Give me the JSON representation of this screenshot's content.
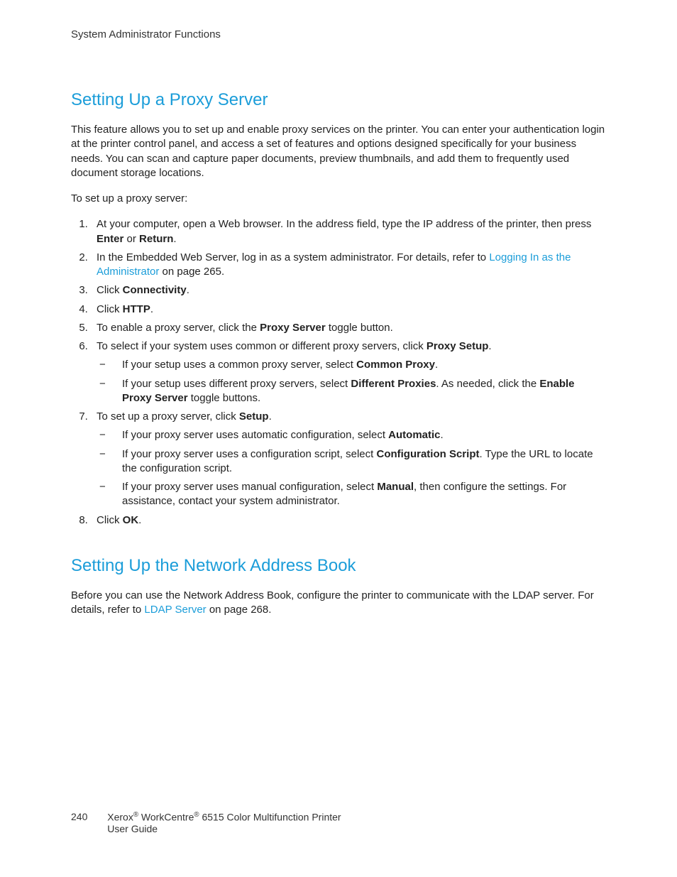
{
  "runningHead": "System Administrator Functions",
  "section1": {
    "title": "Setting Up a Proxy Server",
    "intro": "This feature allows you to set up and enable proxy services on the printer. You can enter your authentication login at the printer control panel, and access a set of features and options designed specifically for your business needs. You can scan and capture paper documents, preview thumbnails, and add them to frequently used document storage locations.",
    "lead": "To set up a proxy server:",
    "step1_a": "At your computer, open a Web browser. In the address field, type the IP address of the printer, then press ",
    "step1_b": "Enter",
    "step1_c": " or ",
    "step1_d": "Return",
    "step1_e": ".",
    "step2_a": "In the Embedded Web Server, log in as a system administrator. For details, refer to ",
    "step2_link": "Logging In as the Administrator",
    "step2_b": " on page 265.",
    "step3_a": "Click ",
    "step3_b": "Connectivity",
    "step3_c": ".",
    "step4_a": "Click ",
    "step4_b": "HTTP",
    "step4_c": ".",
    "step5_a": "To enable a proxy server, click the ",
    "step5_b": "Proxy Server",
    "step5_c": " toggle button.",
    "step6_a": "To select if your system uses common or different proxy servers, click ",
    "step6_b": "Proxy Setup",
    "step6_c": ".",
    "step6_s1_a": "If your setup uses a common proxy server, select ",
    "step6_s1_b": "Common Proxy",
    "step6_s1_c": ".",
    "step6_s2_a": "If your setup uses different proxy servers, select ",
    "step6_s2_b": "Different Proxies",
    "step6_s2_c": ". As needed, click the ",
    "step6_s2_d": "Enable Proxy Server",
    "step6_s2_e": " toggle buttons.",
    "step7_a": "To set up a proxy server, click ",
    "step7_b": "Setup",
    "step7_c": ".",
    "step7_s1_a": "If your proxy server uses automatic configuration, select ",
    "step7_s1_b": "Automatic",
    "step7_s1_c": ".",
    "step7_s2_a": "If your proxy server uses a configuration script, select ",
    "step7_s2_b": "Configuration Script",
    "step7_s2_c": ". Type the URL to locate the configuration script.",
    "step7_s3_a": "If your proxy server uses manual configuration, select ",
    "step7_s3_b": "Manual",
    "step7_s3_c": ", then configure the settings. For assistance, contact your system administrator.",
    "step8_a": "Click ",
    "step8_b": "OK",
    "step8_c": "."
  },
  "section2": {
    "title": "Setting Up the Network Address Book",
    "body_a": "Before you can use the Network Address Book, configure the printer to communicate with the LDAP server. For details, refer to ",
    "body_link": "LDAP Server",
    "body_b": " on page 268."
  },
  "footer": {
    "page": "240",
    "line1_a": "Xerox",
    "line1_b": " WorkCentre",
    "line1_c": " 6515 Color Multifunction Printer",
    "line2": "User Guide"
  }
}
